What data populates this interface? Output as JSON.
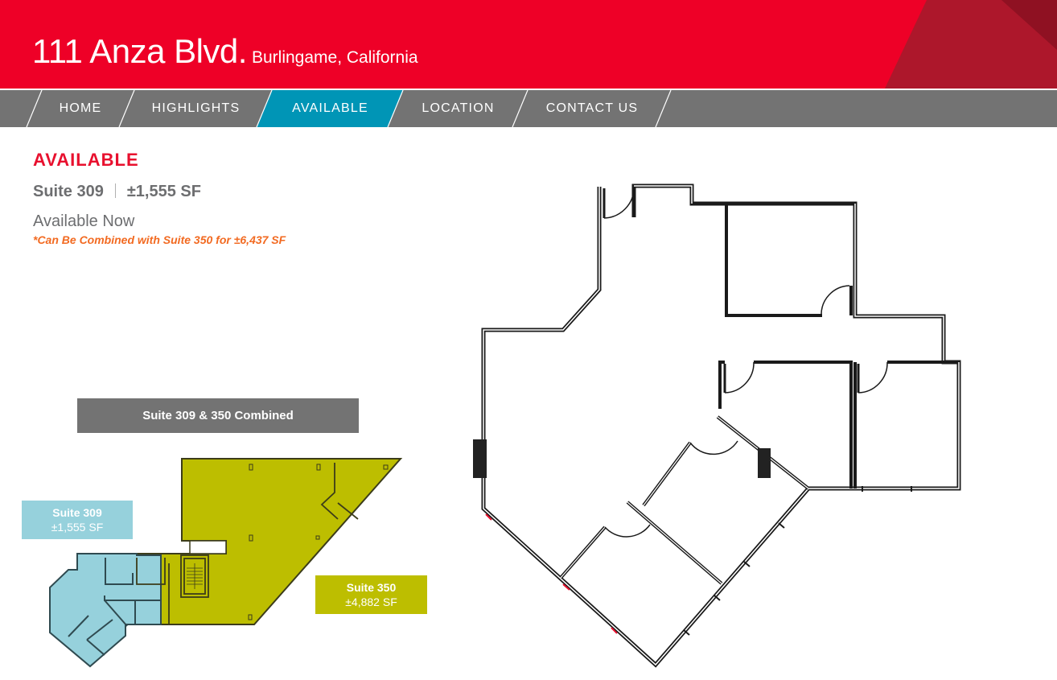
{
  "header": {
    "address": "111 Anza Blvd.",
    "city": "Burlingame, California",
    "brand_color": "#ee0027"
  },
  "nav": {
    "items": [
      {
        "label": "HOME",
        "active": false
      },
      {
        "label": "HIGHLIGHTS",
        "active": false
      },
      {
        "label": "AVAILABLE",
        "active": true
      },
      {
        "label": "LOCATION",
        "active": false
      },
      {
        "label": "CONTACT US",
        "active": false
      }
    ],
    "active_color": "#0095b6"
  },
  "content": {
    "heading": "AVAILABLE",
    "suite": "Suite 309",
    "area": "±1,555 SF",
    "availability": "Available Now",
    "note": "*Can Be Combined with Suite 350 for ±6,437 SF"
  },
  "plans": {
    "combined_label": "Suite 309 & 350 Combined",
    "suite309": {
      "name": "Suite 309",
      "area": "±1,555 SF",
      "color": "#96d1dc"
    },
    "suite350": {
      "name": "Suite 350",
      "area": "±4,882 SF",
      "color": "#bdbe00"
    }
  }
}
